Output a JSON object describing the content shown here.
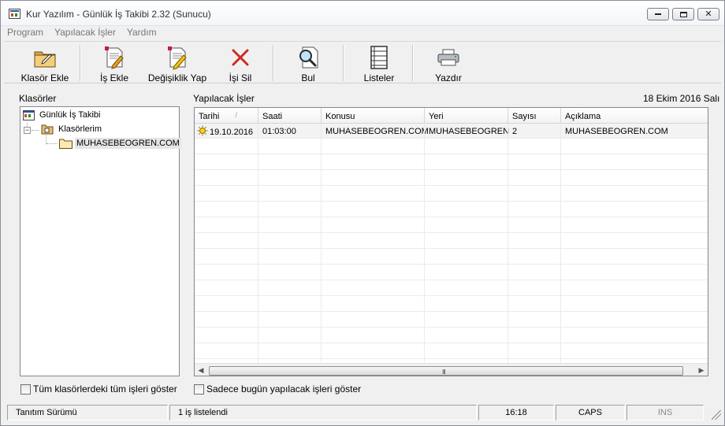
{
  "window": {
    "title": "Kur Yazılım - Günlük İş Takibi 2.32 (Sunucu)"
  },
  "menu": [
    "Program",
    "Yapılacak İşler",
    "Yardım"
  ],
  "toolbar": {
    "folder_add": "Klasör Ekle",
    "task_add": "İş Ekle",
    "edit": "Değişiklik Yap",
    "delete": "İşi Sil",
    "find": "Bul",
    "lists": "Listeler",
    "print": "Yazdır"
  },
  "folders_panel": {
    "label": "Klasörler",
    "tree": {
      "root": "Günlük İş Takibi",
      "group": "Klasörlerim",
      "folder": "MUHASEBEOGREN.COM"
    }
  },
  "tasks_panel": {
    "label": "Yapılacak İşler",
    "date": "18 Ekim 2016 Salı",
    "columns": [
      "Tarihi",
      "Saati",
      "Konusu",
      "Yeri",
      "Sayısı",
      "Açıklama"
    ],
    "rows": [
      [
        "19.10.2016",
        "01:03:00",
        "MUHASEBEOGREN.COM",
        "MUHASEBEOGREN",
        "2",
        "MUHASEBEOGREN.COM"
      ]
    ]
  },
  "checkboxes": {
    "show_all": "Tüm klasörlerdeki tüm işleri göster",
    "today_only": "Sadece bugün yapılacak işleri göster"
  },
  "status": {
    "edition": "Tanıtım Sürümü",
    "count": "1 iş listelendi",
    "time": "16:18",
    "caps": "CAPS",
    "ins": "INS"
  }
}
